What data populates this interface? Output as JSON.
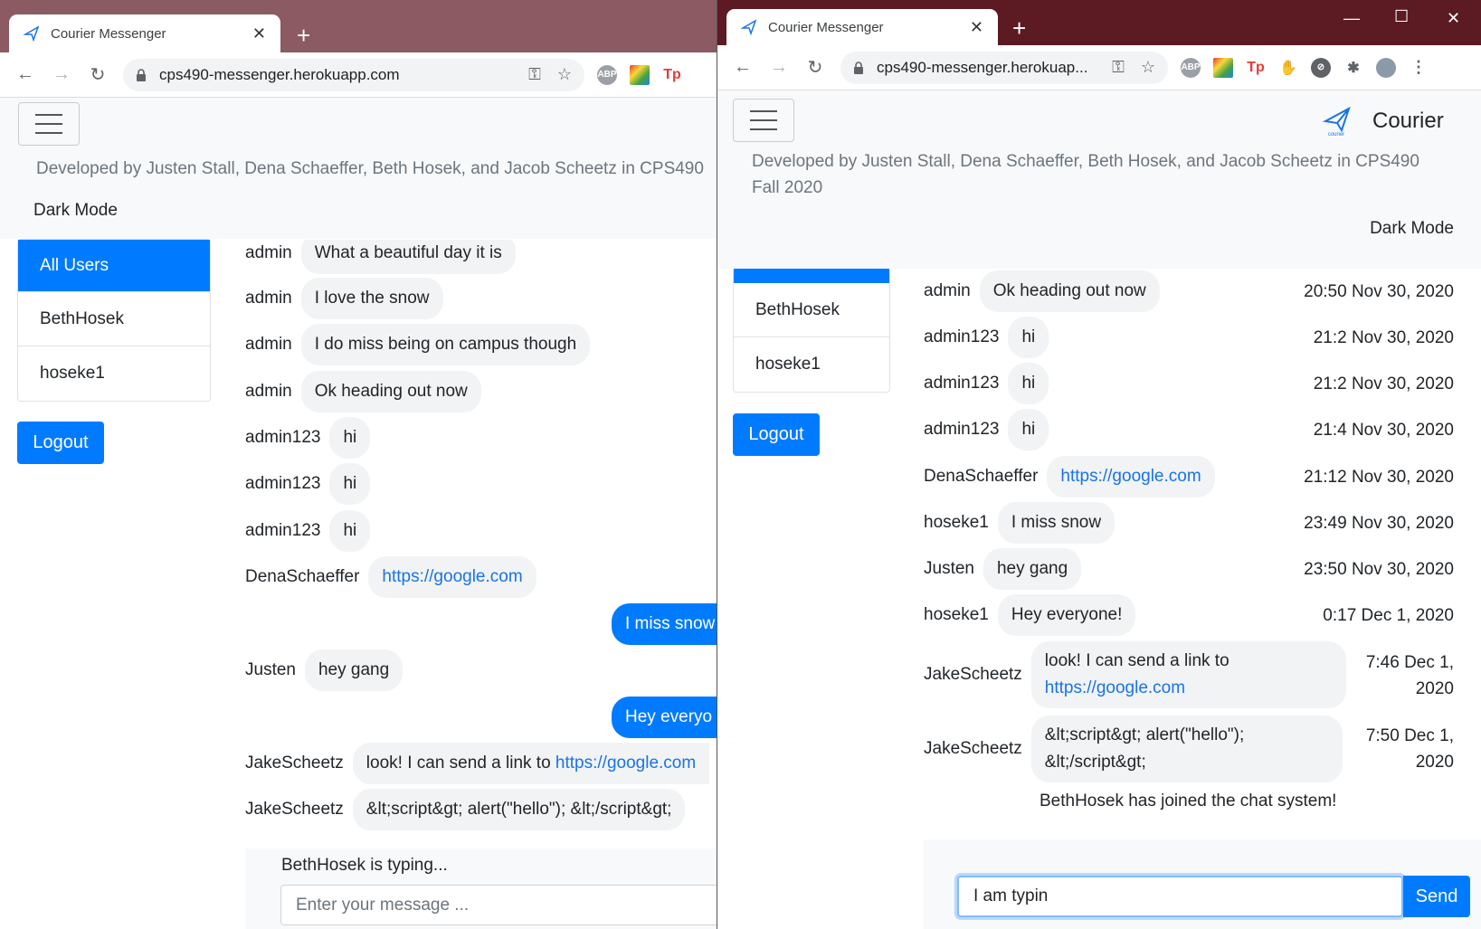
{
  "left": {
    "tab_title": "Courier Messenger",
    "url": "cps490-messenger.herokuapp.com",
    "dev_text": "Developed by Justen Stall, Dena Schaeffer, Beth Hosek, and Jacob Scheetz in CPS490",
    "dark_mode": "Dark Mode",
    "users": [
      "All Users",
      "BethHosek",
      "hoseke1"
    ],
    "logout": "Logout",
    "messages": [
      {
        "user": "admin",
        "text": "What a beautiful day it is"
      },
      {
        "user": "admin",
        "text": "I love the snow"
      },
      {
        "user": "admin",
        "text": "I do miss being on campus though"
      },
      {
        "user": "admin",
        "text": "Ok heading out now"
      },
      {
        "user": "admin123",
        "text": "hi"
      },
      {
        "user": "admin123",
        "text": "hi"
      },
      {
        "user": "admin123",
        "text": "hi"
      },
      {
        "user": "DenaSchaeffer",
        "text": "https://google.com"
      },
      {
        "user": "",
        "text": "I miss snow"
      },
      {
        "user": "Justen",
        "text": "hey gang"
      },
      {
        "user": "",
        "text": "Hey everyo"
      },
      {
        "user": "JakeScheetz",
        "text_prefix": "look! I can send a link to ",
        "link": "https://google.com"
      },
      {
        "user": "JakeScheetz",
        "text": "&lt;script&gt; alert(\"hello\"); &lt;/script&gt;"
      }
    ],
    "typing": "BethHosek is typing...",
    "input_placeholder": "Enter your message ..."
  },
  "right": {
    "tab_title": "Courier Messenger",
    "url": "cps490-messenger.herokuap...",
    "brand": "Courier",
    "logo_caption": "courier",
    "dev_text_1": "Developed by Justen Stall, Dena Schaeffer, Beth Hosek, and Jacob Scheetz in CPS490",
    "dev_text_2": "Fall 2020",
    "dark_mode": "Dark Mode",
    "users": [
      "BethHosek",
      "hoseke1"
    ],
    "logout": "Logout",
    "messages": [
      {
        "user": "admin",
        "text": "Ok heading out now",
        "time": "20:50 Nov 30, 2020"
      },
      {
        "user": "admin123",
        "text": "hi",
        "time": "21:2 Nov 30, 2020"
      },
      {
        "user": "admin123",
        "text": "hi",
        "time": "21:2 Nov 30, 2020"
      },
      {
        "user": "admin123",
        "text": "hi",
        "time": "21:4 Nov 30, 2020"
      },
      {
        "user": "DenaSchaeffer",
        "text": "https://google.com",
        "time": "21:12 Nov 30, 2020"
      },
      {
        "user": "hoseke1",
        "text": "I miss snow",
        "time": "23:49 Nov 30, 2020"
      },
      {
        "user": "Justen",
        "text": "hey gang",
        "time": "23:50 Nov 30, 2020"
      },
      {
        "user": "hoseke1",
        "text": "Hey everyone!",
        "time": "0:17 Dec 1, 2020"
      },
      {
        "user": "JakeScheetz",
        "text_line1": "look! I can send a link to",
        "link": "https://google.com",
        "time_line1": "7:46 Dec 1,",
        "time_line2": "2020"
      },
      {
        "user": "JakeScheetz",
        "text_line1": "&lt;script&gt; alert(\"hello\");",
        "text_line2": "&lt;/script&gt;",
        "time_line1": "7:50 Dec 1,",
        "time_line2": "2020"
      }
    ],
    "join_notice": "BethHosek has joined the chat system!",
    "input_value": "I am typin",
    "send": "Send"
  },
  "colors": {
    "primary": "#007bff",
    "bubble": "#f1f3f4",
    "link": "#1a73e8"
  }
}
